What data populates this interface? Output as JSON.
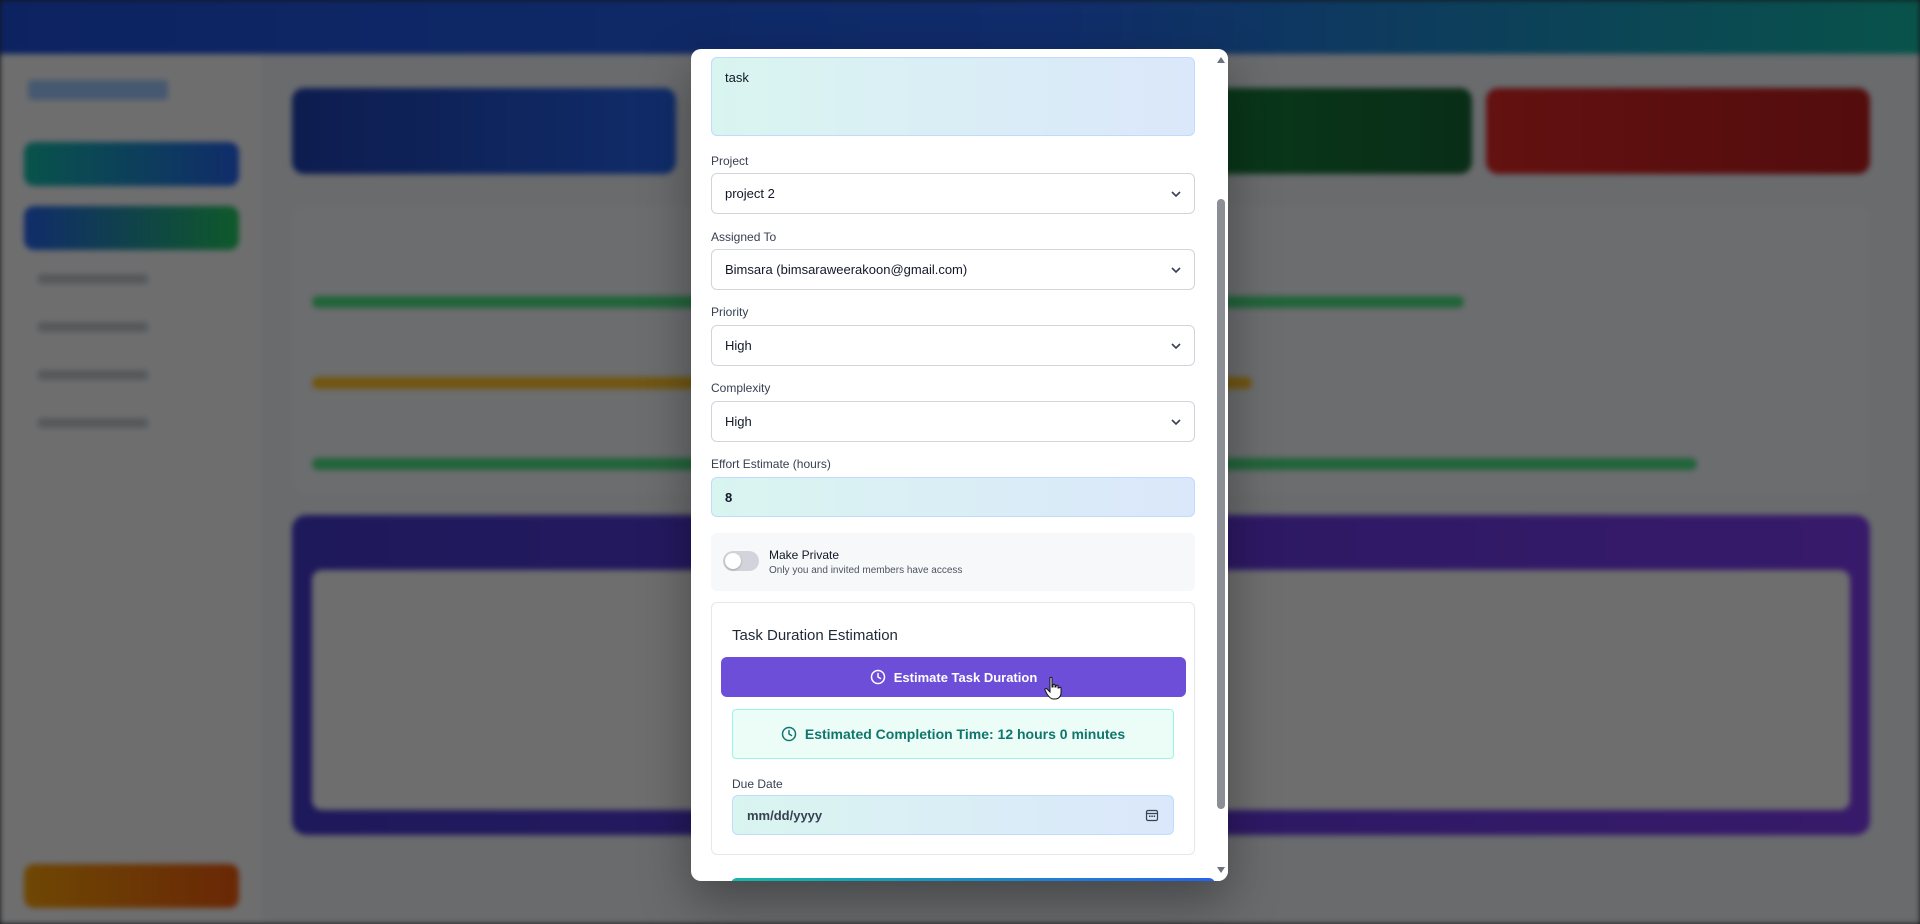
{
  "modal": {
    "task_value": "task",
    "project": {
      "label": "Project",
      "value": "project 2"
    },
    "assigned_to": {
      "label": "Assigned To",
      "value": "Bimsara (bimsaraweerakoon@gmail.com)"
    },
    "priority": {
      "label": "Priority",
      "value": "High"
    },
    "complexity": {
      "label": "Complexity",
      "value": "High"
    },
    "effort": {
      "label": "Effort Estimate (hours)",
      "value": "8"
    },
    "private": {
      "title": "Make Private",
      "subtitle": "Only you and invited members have access",
      "enabled": false
    },
    "estimation": {
      "title": "Task Duration Estimation",
      "button_label": "Estimate Task Duration",
      "result_text": "Estimated Completion Time: 12 hours 0 minutes",
      "due_label": "Due Date",
      "due_placeholder": "mm/dd/yyyy"
    }
  },
  "colors": {
    "primary_button": "#6d4ed8",
    "result_text": "#0f766e",
    "input_gradient_start": "#d9f5f0",
    "input_gradient_end": "#dbe7fb"
  },
  "icons": [
    "chevron-down-icon",
    "clock-icon",
    "calendar-icon",
    "scroll-up-icon",
    "scroll-down-icon",
    "cursor-pointer-icon"
  ]
}
